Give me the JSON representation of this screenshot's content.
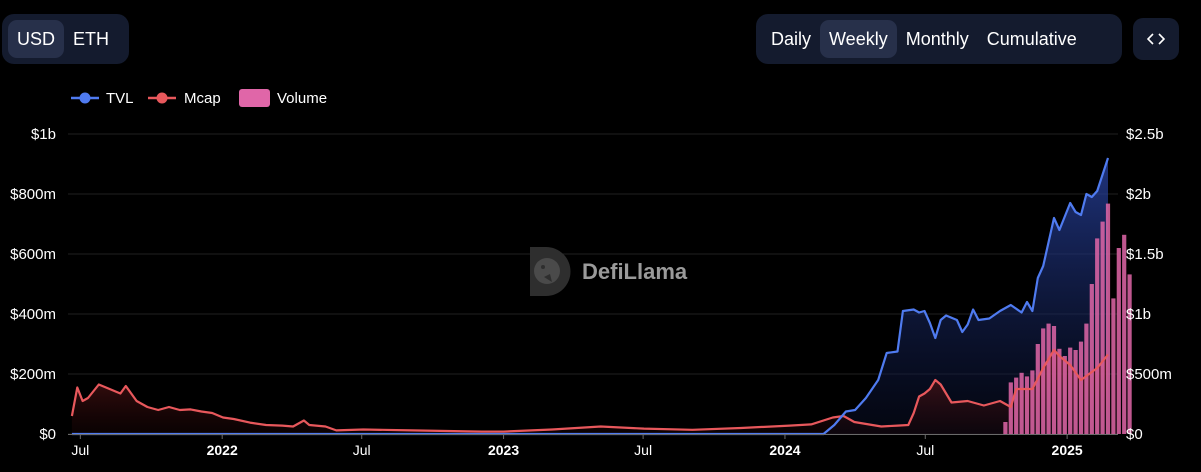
{
  "currency_toggle": {
    "options": [
      {
        "label": "USD",
        "active": true
      },
      {
        "label": "ETH",
        "active": false
      }
    ]
  },
  "period_toggle": {
    "options": [
      {
        "label": "Daily",
        "active": false
      },
      {
        "label": "Weekly",
        "active": true
      },
      {
        "label": "Monthly",
        "active": false
      },
      {
        "label": "Cumulative",
        "active": false
      }
    ]
  },
  "embed_button": {
    "icon": "code-brackets-icon"
  },
  "watermark": "DefiLlama",
  "colors": {
    "tvl": "#4f7bf0",
    "mcap": "#e8585c",
    "volume": "#e066a8",
    "grid": "#1f1f1f",
    "panel": "#141b2e"
  },
  "chart_data": {
    "type": "line",
    "legend": {
      "position": "top-left",
      "items": [
        "TVL",
        "Mcap",
        "Volume"
      ]
    },
    "grid": true,
    "x_axis": {
      "type": "date",
      "min": "2021-06-15",
      "max": "2025-03-08",
      "ticks": [
        {
          "label": "Jul",
          "date": "2021-07-01",
          "year": false
        },
        {
          "label": "2022",
          "date": "2022-01-01",
          "year": true
        },
        {
          "label": "Jul",
          "date": "2022-07-01",
          "year": false
        },
        {
          "label": "2023",
          "date": "2023-01-01",
          "year": true
        },
        {
          "label": "Jul",
          "date": "2023-07-01",
          "year": false
        },
        {
          "label": "2024",
          "date": "2024-01-01",
          "year": true
        },
        {
          "label": "Jul",
          "date": "2024-07-01",
          "year": false
        },
        {
          "label": "2025",
          "date": "2025-01-01",
          "year": true
        }
      ]
    },
    "y_left": {
      "min": 0,
      "max": 1000000000,
      "ticks": [
        {
          "label": "$0",
          "value": 0
        },
        {
          "label": "$200m",
          "value": 200000000
        },
        {
          "label": "$400m",
          "value": 400000000
        },
        {
          "label": "$600m",
          "value": 600000000
        },
        {
          "label": "$800m",
          "value": 800000000
        },
        {
          "label": "$1b",
          "value": 1000000000
        }
      ]
    },
    "y_right": {
      "min": 0,
      "max": 2500000000,
      "ticks": [
        {
          "label": "$0",
          "value": 0
        },
        {
          "label": "$500m",
          "value": 500000000
        },
        {
          "label": "$1b",
          "value": 1000000000
        },
        {
          "label": "$1.5b",
          "value": 1500000000
        },
        {
          "label": "$2b",
          "value": 2000000000
        },
        {
          "label": "$2.5b",
          "value": 2500000000
        }
      ]
    },
    "series": [
      {
        "name": "TVL",
        "axis": "left",
        "kind": "line-area",
        "color": "#4f7bf0",
        "points": [
          [
            "2021-06-20",
            0
          ],
          [
            "2024-02-20",
            0
          ],
          [
            "2024-03-05",
            30000000
          ],
          [
            "2024-03-20",
            75000000
          ],
          [
            "2024-04-01",
            80000000
          ],
          [
            "2024-04-15",
            120000000
          ],
          [
            "2024-05-01",
            180000000
          ],
          [
            "2024-05-12",
            270000000
          ],
          [
            "2024-05-26",
            275000000
          ],
          [
            "2024-06-02",
            410000000
          ],
          [
            "2024-06-16",
            415000000
          ],
          [
            "2024-06-23",
            405000000
          ],
          [
            "2024-06-30",
            410000000
          ],
          [
            "2024-07-07",
            370000000
          ],
          [
            "2024-07-14",
            320000000
          ],
          [
            "2024-07-21",
            380000000
          ],
          [
            "2024-07-28",
            395000000
          ],
          [
            "2024-08-11",
            380000000
          ],
          [
            "2024-08-18",
            340000000
          ],
          [
            "2024-08-25",
            365000000
          ],
          [
            "2024-09-01",
            415000000
          ],
          [
            "2024-09-08",
            380000000
          ],
          [
            "2024-09-22",
            385000000
          ],
          [
            "2024-10-06",
            410000000
          ],
          [
            "2024-10-20",
            430000000
          ],
          [
            "2024-11-03",
            405000000
          ],
          [
            "2024-11-10",
            440000000
          ],
          [
            "2024-11-17",
            410000000
          ],
          [
            "2024-11-24",
            520000000
          ],
          [
            "2024-12-01",
            560000000
          ],
          [
            "2024-12-08",
            640000000
          ],
          [
            "2024-12-15",
            720000000
          ],
          [
            "2024-12-22",
            680000000
          ],
          [
            "2025-01-05",
            770000000
          ],
          [
            "2025-01-12",
            740000000
          ],
          [
            "2025-01-19",
            730000000
          ],
          [
            "2025-01-26",
            800000000
          ],
          [
            "2025-02-02",
            790000000
          ],
          [
            "2025-02-09",
            810000000
          ],
          [
            "2025-02-23",
            920000000
          ]
        ]
      },
      {
        "name": "Mcap",
        "axis": "left",
        "kind": "line-area",
        "color": "#e8585c",
        "points": [
          [
            "2021-06-20",
            60000000
          ],
          [
            "2021-06-27",
            155000000
          ],
          [
            "2021-07-04",
            110000000
          ],
          [
            "2021-07-11",
            120000000
          ],
          [
            "2021-07-25",
            165000000
          ],
          [
            "2021-08-08",
            150000000
          ],
          [
            "2021-08-22",
            135000000
          ],
          [
            "2021-08-29",
            160000000
          ],
          [
            "2021-09-12",
            110000000
          ],
          [
            "2021-09-26",
            90000000
          ],
          [
            "2021-10-10",
            80000000
          ],
          [
            "2021-10-24",
            90000000
          ],
          [
            "2021-11-07",
            80000000
          ],
          [
            "2021-11-21",
            82000000
          ],
          [
            "2021-12-05",
            75000000
          ],
          [
            "2021-12-19",
            70000000
          ],
          [
            "2022-01-02",
            55000000
          ],
          [
            "2022-01-16",
            50000000
          ],
          [
            "2022-02-06",
            38000000
          ],
          [
            "2022-02-27",
            30000000
          ],
          [
            "2022-03-20",
            28000000
          ],
          [
            "2022-04-03",
            25000000
          ],
          [
            "2022-04-17",
            45000000
          ],
          [
            "2022-04-24",
            30000000
          ],
          [
            "2022-05-15",
            25000000
          ],
          [
            "2022-05-29",
            12000000
          ],
          [
            "2022-07-03",
            15000000
          ],
          [
            "2022-09-04",
            12000000
          ],
          [
            "2022-12-04",
            8000000
          ],
          [
            "2023-01-01",
            8000000
          ],
          [
            "2023-03-05",
            15000000
          ],
          [
            "2023-05-07",
            25000000
          ],
          [
            "2023-07-02",
            18000000
          ],
          [
            "2023-09-03",
            14000000
          ],
          [
            "2023-11-05",
            20000000
          ],
          [
            "2024-01-07",
            28000000
          ],
          [
            "2024-02-04",
            32000000
          ],
          [
            "2024-03-03",
            55000000
          ],
          [
            "2024-03-17",
            60000000
          ],
          [
            "2024-03-31",
            40000000
          ],
          [
            "2024-05-05",
            25000000
          ],
          [
            "2024-05-26",
            28000000
          ],
          [
            "2024-06-09",
            30000000
          ],
          [
            "2024-06-16",
            70000000
          ],
          [
            "2024-06-23",
            125000000
          ],
          [
            "2024-06-30",
            135000000
          ],
          [
            "2024-07-07",
            150000000
          ],
          [
            "2024-07-14",
            180000000
          ],
          [
            "2024-07-21",
            165000000
          ],
          [
            "2024-08-04",
            105000000
          ],
          [
            "2024-08-25",
            110000000
          ],
          [
            "2024-09-15",
            95000000
          ],
          [
            "2024-10-06",
            110000000
          ],
          [
            "2024-10-20",
            90000000
          ],
          [
            "2024-10-27",
            150000000
          ],
          [
            "2024-11-03",
            150000000
          ],
          [
            "2024-11-17",
            150000000
          ],
          [
            "2024-12-01",
            220000000
          ],
          [
            "2024-12-15",
            280000000
          ],
          [
            "2024-12-22",
            260000000
          ],
          [
            "2025-01-05",
            230000000
          ],
          [
            "2025-01-19",
            180000000
          ],
          [
            "2025-02-09",
            220000000
          ],
          [
            "2025-02-23",
            265000000
          ]
        ]
      },
      {
        "name": "Volume",
        "axis": "right",
        "kind": "bar",
        "color": "#e066a8",
        "points": [
          [
            "2024-10-13",
            100000000
          ],
          [
            "2024-10-20",
            430000000
          ],
          [
            "2024-10-27",
            470000000
          ],
          [
            "2024-11-03",
            510000000
          ],
          [
            "2024-11-10",
            480000000
          ],
          [
            "2024-11-17",
            530000000
          ],
          [
            "2024-11-24",
            750000000
          ],
          [
            "2024-12-01",
            880000000
          ],
          [
            "2024-12-08",
            920000000
          ],
          [
            "2024-12-15",
            900000000
          ],
          [
            "2024-12-22",
            710000000
          ],
          [
            "2024-12-29",
            650000000
          ],
          [
            "2025-01-05",
            720000000
          ],
          [
            "2025-01-12",
            700000000
          ],
          [
            "2025-01-19",
            770000000
          ],
          [
            "2025-01-26",
            920000000
          ],
          [
            "2025-02-02",
            1250000000
          ],
          [
            "2025-02-09",
            1630000000
          ],
          [
            "2025-02-16",
            1770000000
          ],
          [
            "2025-02-23",
            1920000000
          ],
          [
            "2025-03-02",
            1130000000
          ],
          [
            "2025-03-09",
            1550000000
          ],
          [
            "2025-03-16",
            1660000000
          ],
          [
            "2025-03-23",
            1330000000
          ]
        ]
      }
    ]
  }
}
